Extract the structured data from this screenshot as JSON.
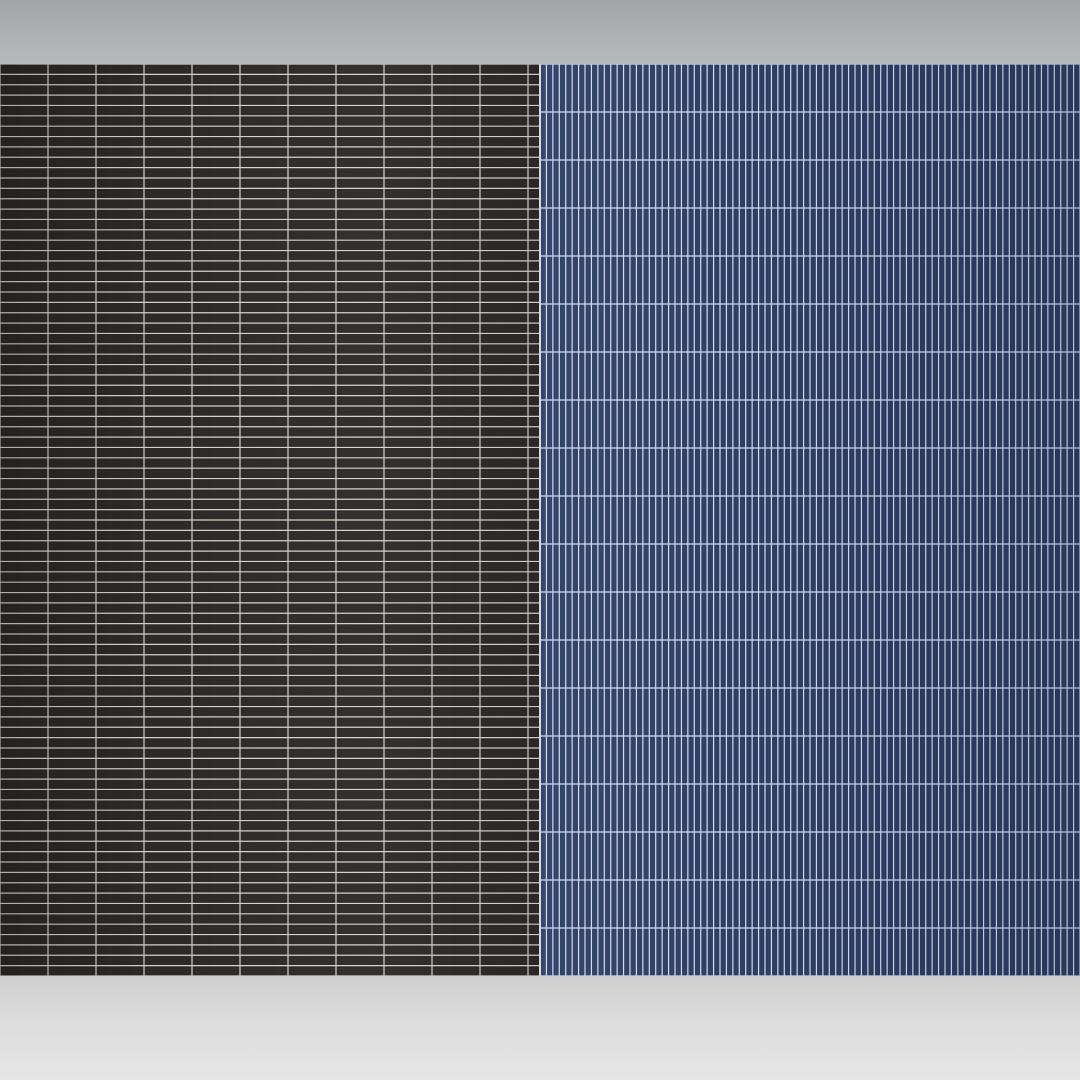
{
  "scene": {
    "wall_background": "#cfcfd0",
    "ceiling_color": "#a8a9ab",
    "floor_color": "#dcdcdc"
  },
  "left_panel": {
    "tile_color": "#2b2a28",
    "grout_color": "#d9d2c4",
    "tile_columns": 11.25,
    "tile_rows": 88,
    "orientation": "horizontal-stack"
  },
  "right_panel": {
    "tile_color": "#2d3e66",
    "grout_color": "#d6dbe6",
    "tile_columns": 84,
    "tile_rows": 19,
    "orientation": "vertical-stack"
  }
}
